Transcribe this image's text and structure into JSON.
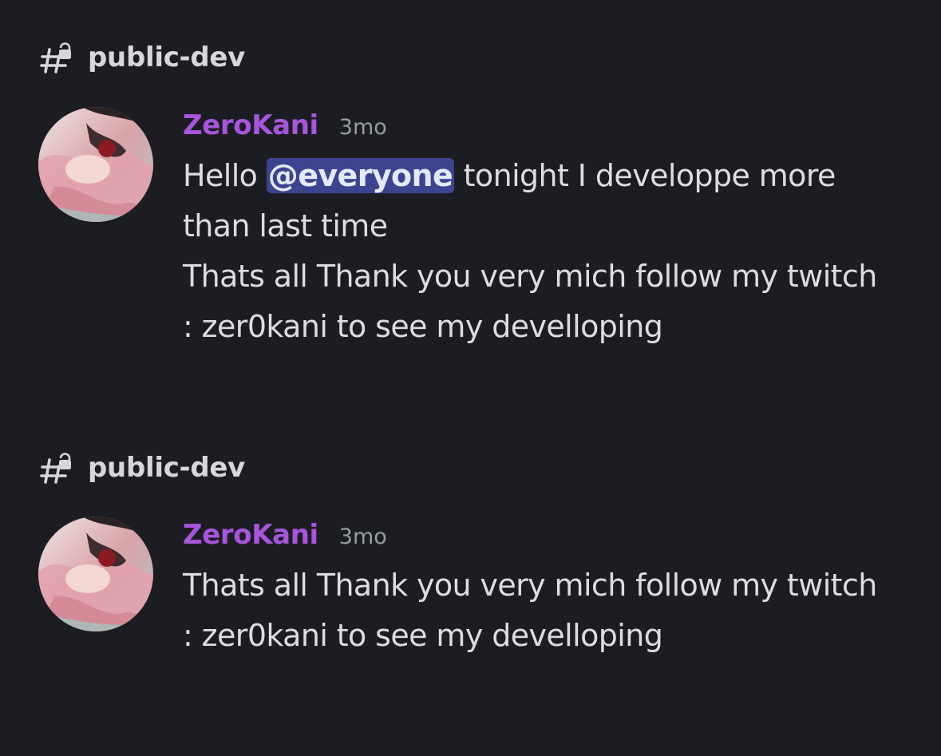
{
  "results": [
    {
      "channel": {
        "name": "public-dev",
        "icon": "locked-channel-hash-icon"
      },
      "message": {
        "author": "ZeroKani",
        "author_color": "#a855dd",
        "timestamp": "3mo",
        "avatar_icon": "user-avatar",
        "line1_before": "Hello ",
        "mention": "@everyone",
        "line1_after": " tonight I developpe more than last time",
        "line2": "Thats all Thank you very mich follow my twitch : zer0kani to see my develloping"
      }
    },
    {
      "channel": {
        "name": "public-dev",
        "icon": "locked-channel-hash-icon"
      },
      "message": {
        "author": "ZeroKani",
        "author_color": "#a855dd",
        "timestamp": "3mo",
        "avatar_icon": "user-avatar",
        "text": "Thats all Thank you very mich follow my twitch : zer0kani to see my develloping"
      }
    }
  ],
  "colors": {
    "background": "#1c1d22",
    "mention_bg": "#3c4490"
  }
}
